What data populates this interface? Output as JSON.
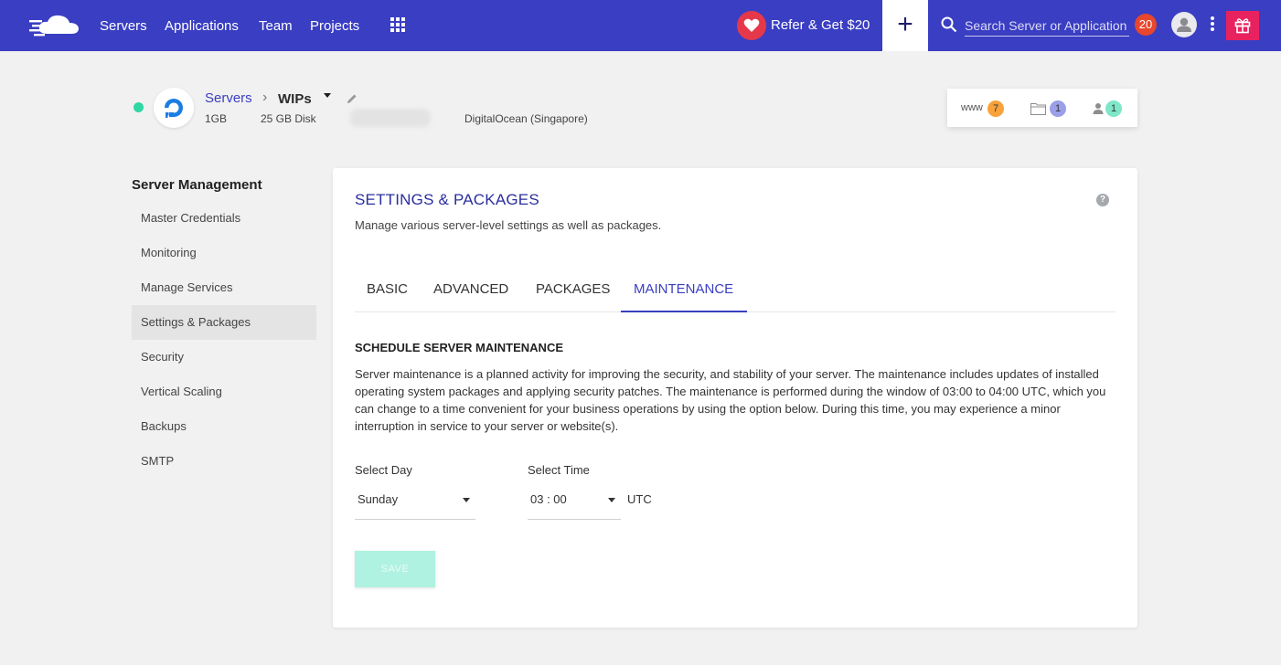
{
  "topbar": {
    "nav": [
      "Servers",
      "Applications",
      "Team",
      "Projects"
    ],
    "refer_label": "Refer & Get $20",
    "add_label": "+",
    "search_placeholder": "Search Server or Application",
    "notification_count": "20",
    "colors": {
      "bar": "#3a3ec2",
      "gift": "#e8225f",
      "heart": "#e5384a",
      "badge": "#e8462d"
    }
  },
  "server": {
    "breadcrumb_root": "Servers",
    "breadcrumb_sep": "›",
    "name": "WIPs",
    "size": "1GB",
    "disk": "25 GB Disk",
    "provider": "DigitalOcean (Singapore)",
    "status_color": "#2fd7a4",
    "counters": [
      {
        "label": "www",
        "count": "7",
        "icon": "www-icon",
        "color": "#f7a23b"
      },
      {
        "label": "",
        "count": "1",
        "icon": "folder-icon",
        "color": "#9b9ee8"
      },
      {
        "label": "",
        "count": "1",
        "icon": "user-icon",
        "color": "#7ee7c7"
      }
    ]
  },
  "sidebar": {
    "title": "Server Management",
    "items": [
      {
        "label": "Master Credentials"
      },
      {
        "label": "Monitoring"
      },
      {
        "label": "Manage Services"
      },
      {
        "label": "Settings & Packages"
      },
      {
        "label": "Security"
      },
      {
        "label": "Vertical Scaling"
      },
      {
        "label": "Backups"
      },
      {
        "label": "SMTP"
      }
    ],
    "active_index": 3
  },
  "main": {
    "title": "SETTINGS & PACKAGES",
    "subtitle": "Manage various server-level settings as well as packages.",
    "help": "?",
    "tabs": [
      {
        "label": "BASIC"
      },
      {
        "label": "ADVANCED"
      },
      {
        "label": "PACKAGES"
      },
      {
        "label": "MAINTENANCE"
      }
    ],
    "active_tab": 3,
    "section_title": "SCHEDULE SERVER MAINTENANCE",
    "description": "Server maintenance is a planned activity for improving the security, and stability of your server. The maintenance includes updates of installed operating system packages and applying security patches. The maintenance is performed during the window of 03:00 to 04:00 UTC, which you can change to a time convenient for your business operations by using the option below. During this time, you may experience a minor interruption in service to your server or website(s).",
    "day_label": "Select Day",
    "day_value": "Sunday",
    "time_label": "Select Time",
    "time_value": "03 : 00",
    "timezone": "UTC",
    "save_label": "SAVE"
  }
}
